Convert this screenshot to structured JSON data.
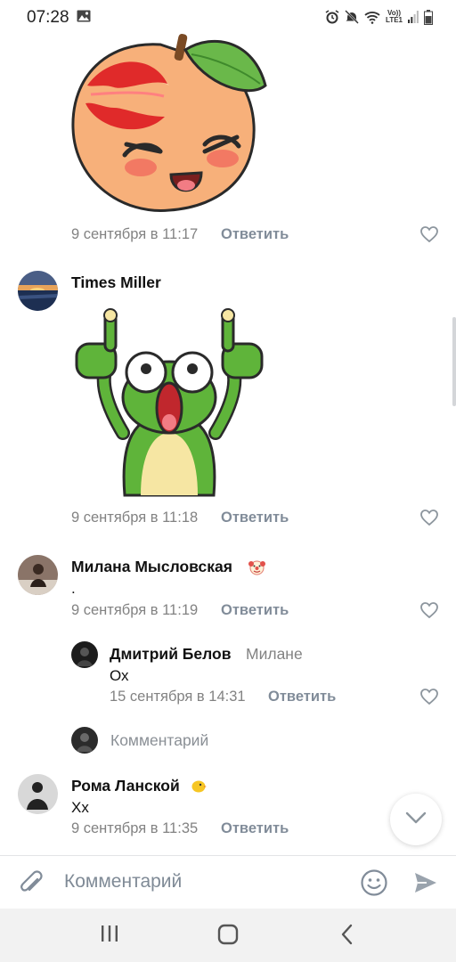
{
  "status_bar": {
    "time": "07:28",
    "volte_top": "Vo))",
    "volte_bottom": "LTE1",
    "icons": [
      "gallery-icon",
      "alarm-icon",
      "mute-icon",
      "wifi-icon",
      "signal-icon",
      "battery-icon"
    ]
  },
  "comments": [
    {
      "sticker": "peach-sticker",
      "date": "9 сентября в 11:17",
      "reply_label": "Ответить"
    },
    {
      "author": "Times Miller",
      "sticker": "frog-sticker",
      "date": "9 сентября в 11:18",
      "reply_label": "Ответить"
    },
    {
      "author": "Милана Мысловская",
      "text": ".",
      "date": "9 сентября в 11:19",
      "reply_label": "Ответить",
      "reply": {
        "author": "Дмитрий Белов",
        "to": "Милане",
        "text": "Ох",
        "date": "15 сентября в 14:31",
        "reply_label": "Ответить"
      },
      "thread_comment_placeholder": "Комментарий"
    },
    {
      "author": "Рома Ланской",
      "text": "Хх",
      "date": "9 сентября в 11:35",
      "reply_label": "Ответить"
    }
  ],
  "input": {
    "placeholder": "Комментарий"
  },
  "colors": {
    "meta": "#828282",
    "accent_gray": "#818c99",
    "nav_bg": "#f2f2f2"
  }
}
